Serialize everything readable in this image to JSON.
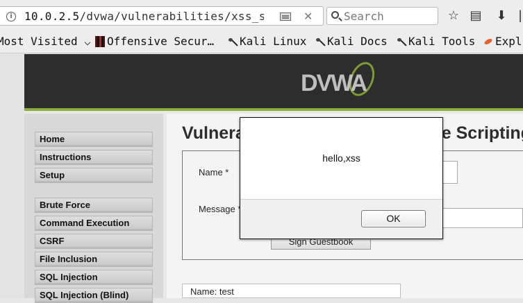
{
  "browser": {
    "url": {
      "host": "10.0.2.5",
      "path": "/dvwa/vulnerabilities/xss_s"
    },
    "search_placeholder": "Search",
    "bookmarks": [
      {
        "label": "Most Visited",
        "icon": "dropdown-arrow"
      },
      {
        "label": "Offensive Secur…",
        "icon": "offensive-security-icon"
      },
      {
        "label": "Kali Linux",
        "icon": "kali-dragon-icon"
      },
      {
        "label": "Kali Docs",
        "icon": "kali-dragon-icon"
      },
      {
        "label": "Kali Tools",
        "icon": "kali-dragon-icon"
      },
      {
        "label": "Expl",
        "icon": "exploit-db-icon"
      }
    ],
    "icons": [
      "info-icon",
      "reader-view-icon",
      "clear-url-icon",
      "search-icon",
      "bookmark-star-icon",
      "library-icon",
      "download-icon"
    ]
  },
  "site": {
    "logo": "DVWA",
    "title_visible": {
      "left": "Vulnera",
      "right": "e Scripting"
    },
    "menu": [
      "Home",
      "Instructions",
      "Setup",
      "Brute Force",
      "Command Execution",
      "CSRF",
      "File Inclusion",
      "SQL Injection",
      "SQL Injection (Blind)"
    ],
    "form": {
      "name_label": "Name *",
      "message_label": "Message *",
      "button": "Sign Guestbook"
    },
    "entry": "Name: test"
  },
  "dialog": {
    "message": "hello,xss",
    "button": "OK"
  },
  "colors": {
    "header": "#2d2d2d",
    "accent": "#8cae3c"
  }
}
